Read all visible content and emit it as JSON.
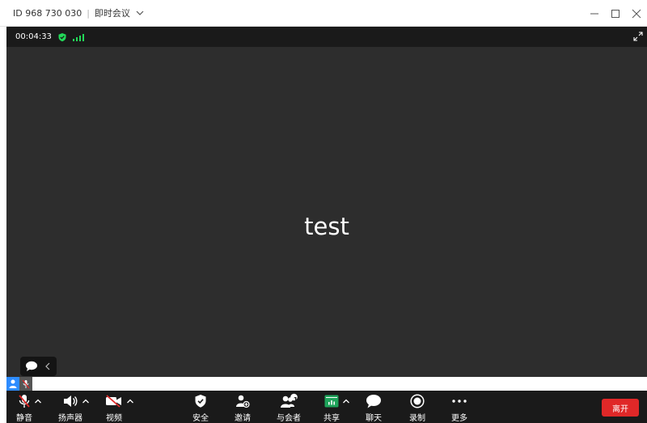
{
  "titlebar": {
    "meeting_id": "ID 968 730 030",
    "separator": "|",
    "meeting_type": "即时会议",
    "controls": [
      "minimize-icon",
      "maximize-icon",
      "close-icon"
    ]
  },
  "status": {
    "elapsed": "00:04:33",
    "encryption_icon": "shield-check-icon",
    "signal_icon": "signal-bars-icon",
    "expand_icon": "fullscreen-icon",
    "signal_color": "#23d959"
  },
  "video": {
    "participant_name": "test"
  },
  "chat_toggle": {
    "icon": "chat-bubble-icon",
    "arrow": "chevron-left-icon"
  },
  "toolbar": {
    "mute_label": "静音",
    "speaker_label": "扬声器",
    "video_label": "视频",
    "security_label": "安全",
    "invite_label": "邀请",
    "participants_label": "与会者",
    "participants_count": "1",
    "share_label": "共享",
    "chat_label": "聊天",
    "record_label": "录制",
    "more_label": "更多",
    "leave_label": "离开"
  },
  "colors": {
    "accent_blue": "#2d8cff",
    "leave_red": "#e02828",
    "share_green": "#1ea35a",
    "video_bg": "#2d2d2d",
    "toolbar_bg": "#1a1a1a",
    "muted_red": "#e02828"
  }
}
